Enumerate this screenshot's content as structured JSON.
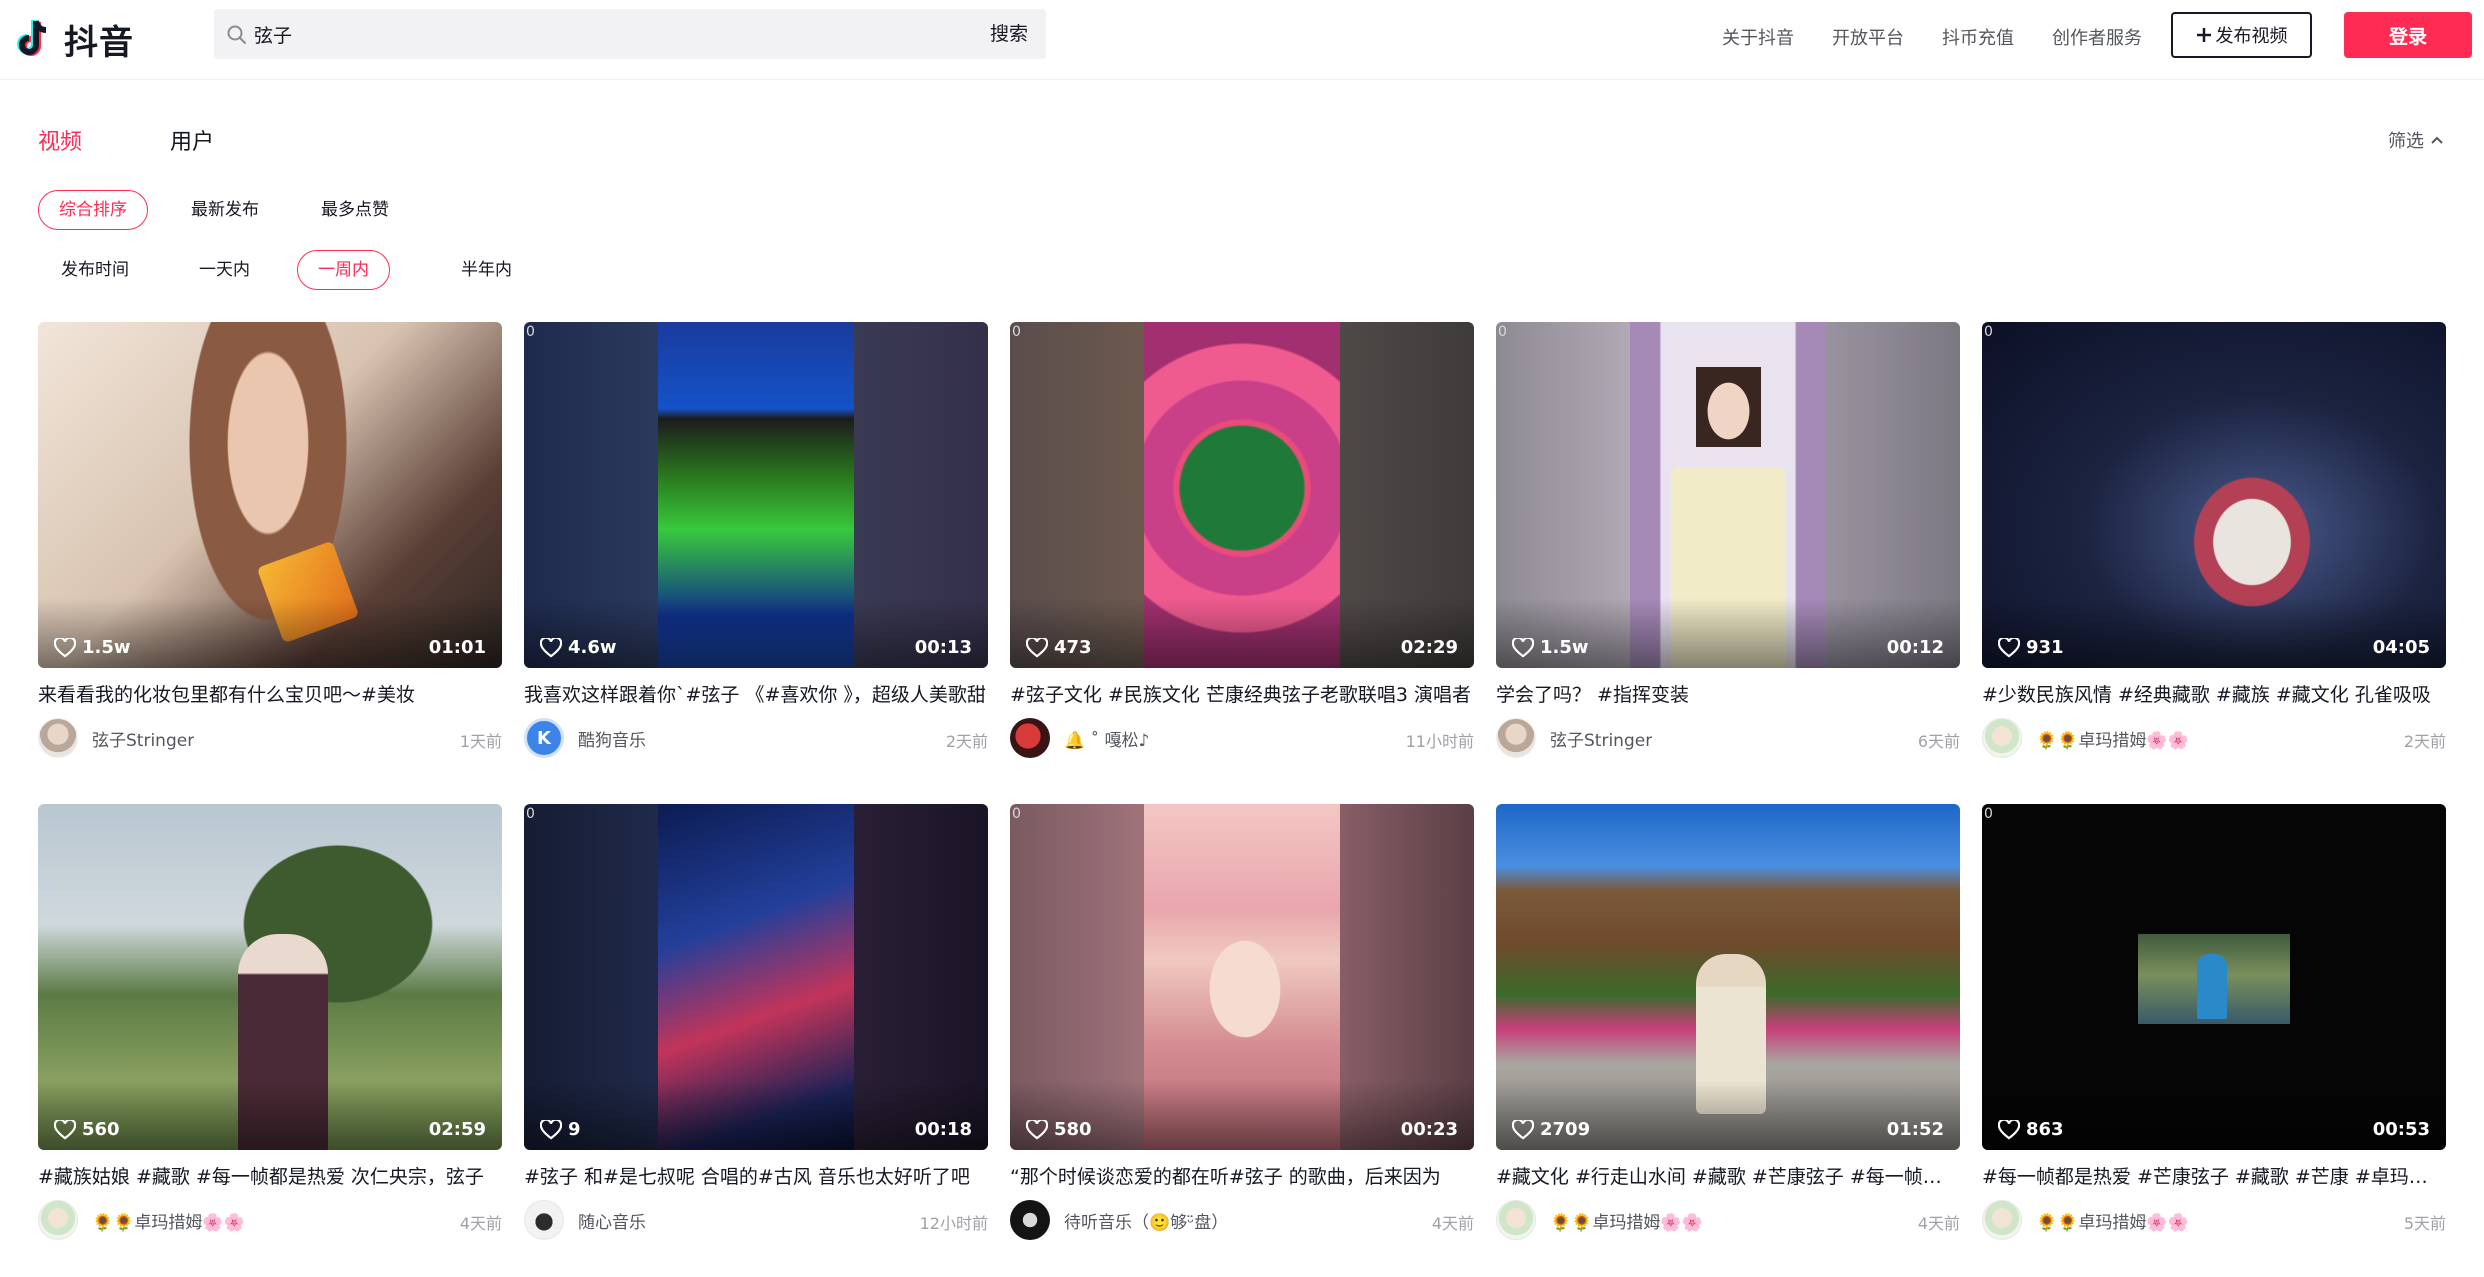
{
  "header": {
    "logo_text": "抖音",
    "search_value": "弦子",
    "search_button": "搜索",
    "nav": [
      "关于抖音",
      "开放平台",
      "抖币充值",
      "创作者服务"
    ],
    "publish_label": "发布视频",
    "login_label": "登录",
    "brand_color": "#fe2c55"
  },
  "tabs": {
    "video": "视频",
    "user": "用户",
    "filter": "筛选"
  },
  "sort_options": [
    "综合排序",
    "最新发布",
    "最多点赞"
  ],
  "sort_selected": "综合排序",
  "time_options": [
    "发布时间",
    "一天内",
    "一周内",
    "半年内"
  ],
  "time_selected": "一周内",
  "videos": [
    {
      "likes": "1.5w",
      "duration": "01:01",
      "title": "来看看我的化妆包里都有什么宝贝吧～#美妆",
      "author": "弦子Stringer",
      "time": "1天前"
    },
    {
      "likes": "4.6w",
      "duration": "00:13",
      "title": "我喜欢这样跟着你`#弦子 《#喜欢你 》，超级人美歌甜",
      "author": "酷狗音乐",
      "time": "2天前"
    },
    {
      "likes": "473",
      "duration": "02:29",
      "title": "#弦子文化 #民族文化 芒康经典弦子老歌联唱3 演唱者",
      "author": "🔔 ˚ 嘎松♪",
      "time": "11小时前"
    },
    {
      "likes": "1.5w",
      "duration": "00:12",
      "title": "学会了吗？ #指挥变装",
      "author": "弦子Stringer",
      "time": "6天前"
    },
    {
      "likes": "931",
      "duration": "04:05",
      "title": "#少数民族风情 #经典藏歌 #藏族 #藏文化 孔雀吸吸",
      "author": "🌻🌻卓玛措姆🌸🌸",
      "time": "2天前"
    },
    {
      "likes": "560",
      "duration": "02:59",
      "title": "#藏族姑娘 #藏歌 #每一帧都是热爱 次仁央宗，弦子",
      "author": "🌻🌻卓玛措姆🌸🌸",
      "time": "4天前"
    },
    {
      "likes": "9",
      "duration": "00:18",
      "title": "#弦子 和#是七叔呢 合唱的#古风 音乐也太好听了吧",
      "author": "随心音乐",
      "time": "12小时前"
    },
    {
      "likes": "580",
      "duration": "00:23",
      "title": "“那个时候谈恋爱的都在听#弦子 的歌曲，后来因为",
      "author": "待听音乐（🙂够ᵕ̈盘）",
      "time": "4天前"
    },
    {
      "likes": "2709",
      "duration": "01:52",
      "title": "#藏文化 #行走山水间 #藏歌 #芒康弦子 #每一帧都是",
      "author": "🌻🌻卓玛措姆🌸🌸",
      "time": "4天前"
    },
    {
      "likes": "863",
      "duration": "00:53",
      "title": "#每一帧都是热爱 #芒康弦子 #藏歌 #芒康 #卓玛央宗",
      "author": "🌻🌻卓玛措姆🌸🌸",
      "time": "5天前"
    }
  ],
  "thumb_zero": "0"
}
